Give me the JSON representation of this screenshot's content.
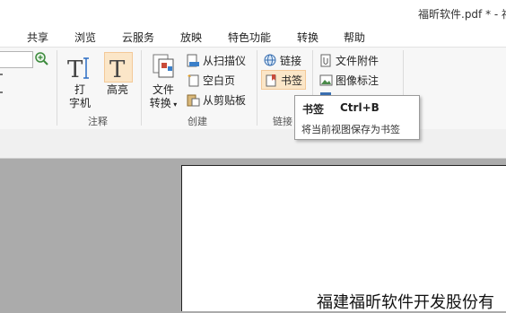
{
  "window": {
    "title": "福昕软件.pdf * - 福"
  },
  "menu": [
    "共享",
    "浏览",
    "云服务",
    "放映",
    "特色功能",
    "转换",
    "帮助"
  ],
  "ribbon": {
    "typewriter_label_1": "打",
    "typewriter_label_2": "字机",
    "highlight_label": "高亮",
    "annotate_group": "注释",
    "convert_label_1": "文件",
    "convert_label_2": "转换",
    "from_scanner": "从扫描仪",
    "blank_page": "空白页",
    "from_clipboard": "从剪贴板",
    "create_group": "创建",
    "link": "链接",
    "bookmark": "书签",
    "links_group": "链接",
    "file_attachment": "文件附件",
    "image_annotation": "图像标注"
  },
  "tooltip": {
    "title": "书签",
    "shortcut": "Ctrl+B",
    "description": "将当前视图保存为书签"
  },
  "document": {
    "text": "福建福昕软件开发股份有"
  },
  "colors": {
    "highlight_button_bg": "#fbe6c8",
    "workspace_bg": "#ababab"
  }
}
